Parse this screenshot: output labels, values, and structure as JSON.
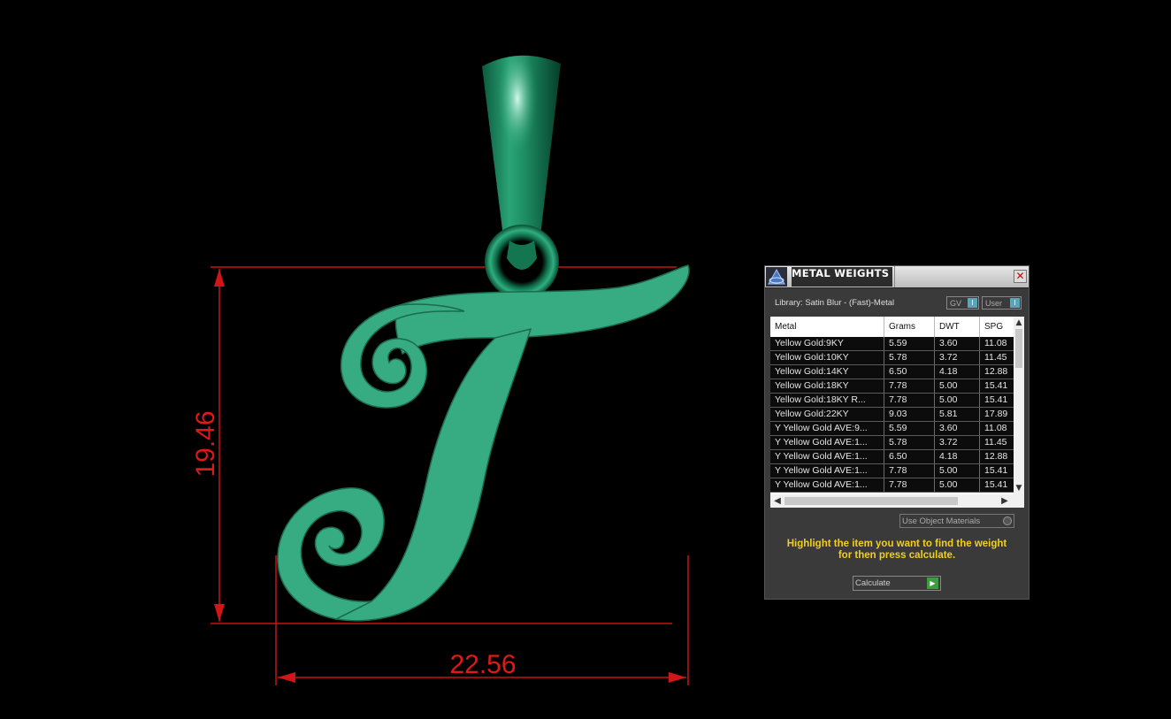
{
  "viewport": {
    "dimension_height": "19.46",
    "dimension_width": "22.56",
    "model_color": "#37ab82",
    "dimension_color": "#e01818"
  },
  "panel": {
    "title": "METAL WEIGHTS",
    "close_icon": "close-icon",
    "library_label": "Library: Satin Blur - (Fast)-Metal",
    "toggle_gv_label": "GV",
    "toggle_user_label": "User",
    "toggle_knob": "I",
    "columns": [
      "Metal",
      "Grams",
      "DWT",
      "SPG"
    ],
    "rows": [
      [
        "Yellow Gold:9KY",
        "5.59",
        "3.60",
        "11.08"
      ],
      [
        "Yellow Gold:10KY",
        "5.78",
        "3.72",
        "11.45"
      ],
      [
        "Yellow Gold:14KY",
        "6.50",
        "4.18",
        "12.88"
      ],
      [
        "Yellow Gold:18KY",
        "7.78",
        "5.00",
        "15.41"
      ],
      [
        "Yellow Gold:18KY R...",
        "7.78",
        "5.00",
        "15.41"
      ],
      [
        "Yellow Gold:22KY",
        "9.03",
        "5.81",
        "17.89"
      ],
      [
        "Y Yellow Gold AVE:9...",
        "5.59",
        "3.60",
        "11.08"
      ],
      [
        "Y Yellow Gold AVE:1...",
        "5.78",
        "3.72",
        "11.45"
      ],
      [
        "Y Yellow Gold AVE:1...",
        "6.50",
        "4.18",
        "12.88"
      ],
      [
        "Y Yellow Gold AVE:1...",
        "7.78",
        "5.00",
        "15.41"
      ],
      [
        "Y Yellow Gold AVE:1...",
        "7.78",
        "5.00",
        "15.41"
      ]
    ],
    "use_object_materials": "Use Object Materials",
    "hint_line1": "Highlight the item you want to find the weight",
    "hint_line2": "for then press calculate.",
    "calculate_label": "Calculate",
    "hint_color": "#f2cf1c"
  }
}
